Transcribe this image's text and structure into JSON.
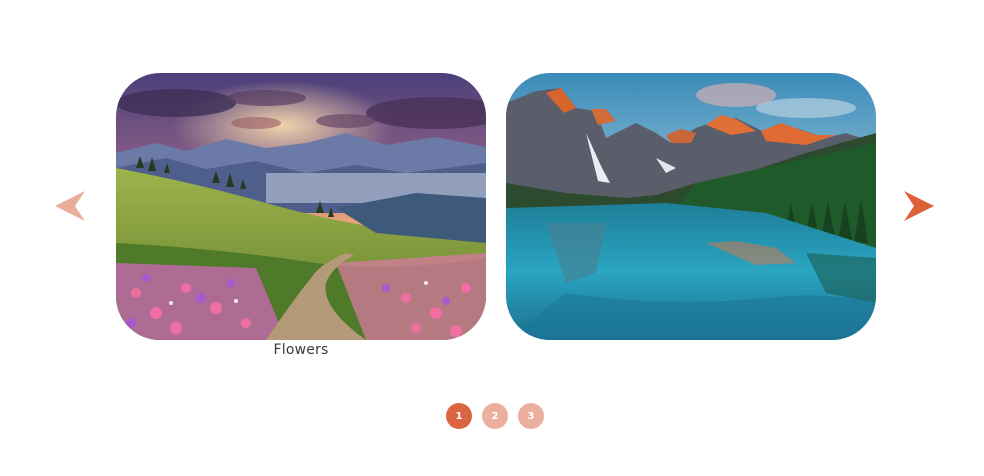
{
  "carousel": {
    "prev_icon": "chevron-left-arrow-icon",
    "next_icon": "chevron-right-arrow-icon",
    "slides": [
      {
        "caption": "Flowers",
        "image": "mountain-flower-meadow-photo"
      },
      {
        "caption": "",
        "image": "mountain-lake-reflection-photo"
      }
    ],
    "pagination": {
      "pages": [
        "1",
        "2",
        "3"
      ],
      "active_index": 0
    }
  },
  "colors": {
    "accent": "#de6038",
    "accent_muted": "#eaad99",
    "dot_active": "#d9643f",
    "dot_inactive": "#ebb09d"
  }
}
